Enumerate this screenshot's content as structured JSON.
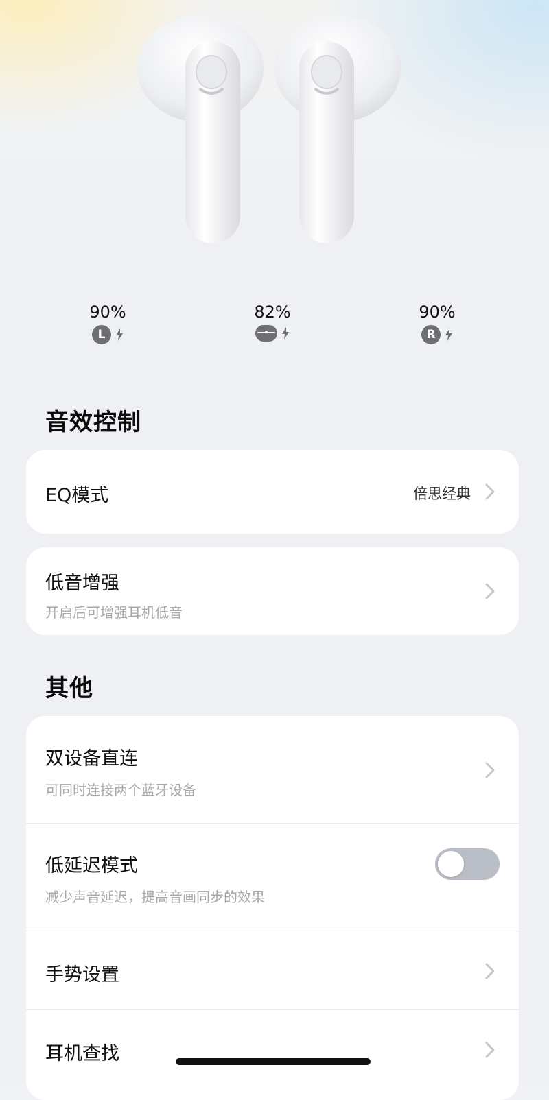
{
  "battery": {
    "left": {
      "percent": "90%",
      "label": "L"
    },
    "case": {
      "percent": "82%"
    },
    "right": {
      "percent": "90%",
      "label": "R"
    }
  },
  "sound_section": {
    "title": "音效控制",
    "eq": {
      "title": "EQ模式",
      "value": "倍思经典"
    },
    "bass": {
      "title": "低音增强",
      "subtitle": "开启后可增强耳机低音"
    }
  },
  "other_section": {
    "title": "其他",
    "items": [
      {
        "title": "双设备直连",
        "subtitle": "可同时连接两个蓝牙设备"
      },
      {
        "title": "低延迟模式",
        "subtitle": "减少声音延迟，提高音画同步的效果",
        "toggle_on": false
      },
      {
        "title": "手势设置"
      },
      {
        "title": "耳机查找"
      }
    ]
  },
  "colors": {
    "background": "#f1f2f6",
    "card": "#ffffff",
    "toggle_off": "#b9bdc6",
    "badge": "#6e6f74",
    "subtext": "#a6a8ad"
  }
}
